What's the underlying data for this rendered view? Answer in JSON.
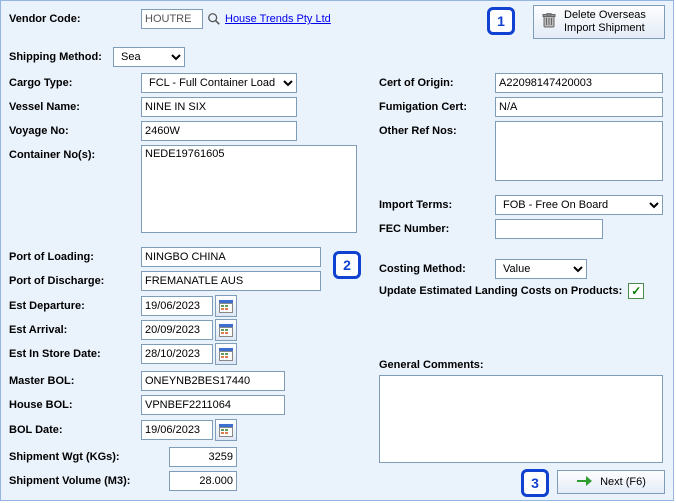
{
  "labels": {
    "vendorCode": "Vendor Code:",
    "shippingMethod": "Shipping Method:",
    "cargoType": "Cargo Type:",
    "vesselName": "Vessel Name:",
    "voyageNo": "Voyage No:",
    "containerNos": "Container No(s):",
    "portOfLoading": "Port of Loading:",
    "portOfDischarge": "Port of Discharge:",
    "estDeparture": "Est Departure:",
    "estArrival": "Est Arrival:",
    "estInStore": "Est In Store Date:",
    "masterBol": "Master BOL:",
    "houseBol": "House BOL:",
    "bolDate": "BOL Date:",
    "shipmentWgt": "Shipment Wgt (KGs):",
    "shipmentVol": "Shipment Volume (M3):",
    "certOfOrigin": "Cert of Origin:",
    "fumigationCert": "Fumigation Cert:",
    "otherRefNos": "Other Ref Nos:",
    "importTerms": "Import Terms:",
    "fecNumber": "FEC Number:",
    "costingMethod": "Costing Method:",
    "updateEstimated": "Update Estimated Landing Costs on Products:",
    "generalComments": "General Comments:"
  },
  "values": {
    "vendorCode": "HOUTRE",
    "vendorLink": "House Trends Pty Ltd",
    "shippingMethod": "Sea",
    "cargoType": "FCL - Full Container Load",
    "vesselName": "NINE IN SIX",
    "voyageNo": "2460W",
    "containerNos": "NEDE19761605",
    "portOfLoading": "NINGBO CHINA",
    "portOfDischarge": "FREMANATLE AUS",
    "estDeparture": "19/06/2023",
    "estArrival": "20/09/2023",
    "estInStore": "28/10/2023",
    "masterBol": "ONEYNB2BES17440",
    "houseBol": "VPNBEF2211064",
    "bolDate": "19/06/2023",
    "shipmentWgt": "3259",
    "shipmentVol": "28.000",
    "certOfOrigin": "A22098147420003",
    "fumigationCert": "N/A",
    "otherRefNos": "",
    "importTerms": "FOB - Free On Board",
    "fecNumber": "",
    "costingMethod": "Value",
    "generalComments": ""
  },
  "buttons": {
    "delete": "Delete Overseas\nImport Shipment",
    "next": "Next (F6)"
  },
  "callouts": {
    "c1": "1",
    "c2": "2",
    "c3": "3"
  }
}
